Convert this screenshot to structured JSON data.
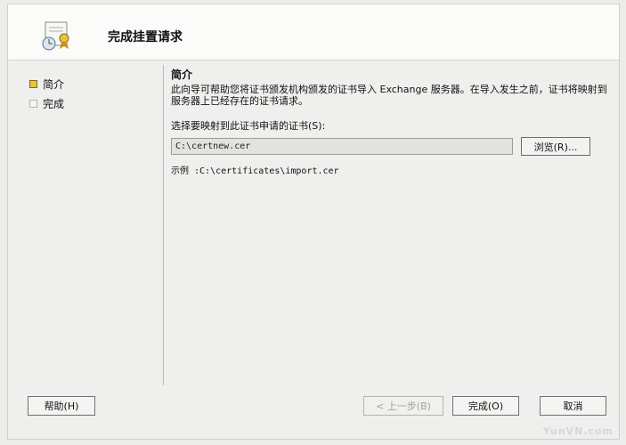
{
  "header": {
    "title": "完成挂置请求",
    "icon": "certificate-wizard-icon"
  },
  "nav": {
    "items": [
      {
        "label": "简介",
        "state": "active"
      },
      {
        "label": "完成",
        "state": "inactive"
      }
    ]
  },
  "content": {
    "section_title": "简介",
    "description": "此向导可帮助您将证书颁发机构颁发的证书导入 Exchange 服务器。在导入发生之前，证书将映射到服务器上已经存在的证书请求。",
    "field_label": "选择要映射到此证书申请的证书(S):",
    "path_value": "C:\\certnew.cer",
    "browse_label": "浏览(R)...",
    "example_text": "示例 :C:\\certificates\\import.cer"
  },
  "buttons": {
    "help": "帮助(H)",
    "back": "< 上一步(B)",
    "finish": "完成(O)",
    "cancel": "取消"
  },
  "watermark": "YunVN.com",
  "colors": {
    "active_bullet": "#e4c83c",
    "background": "#efefed"
  }
}
